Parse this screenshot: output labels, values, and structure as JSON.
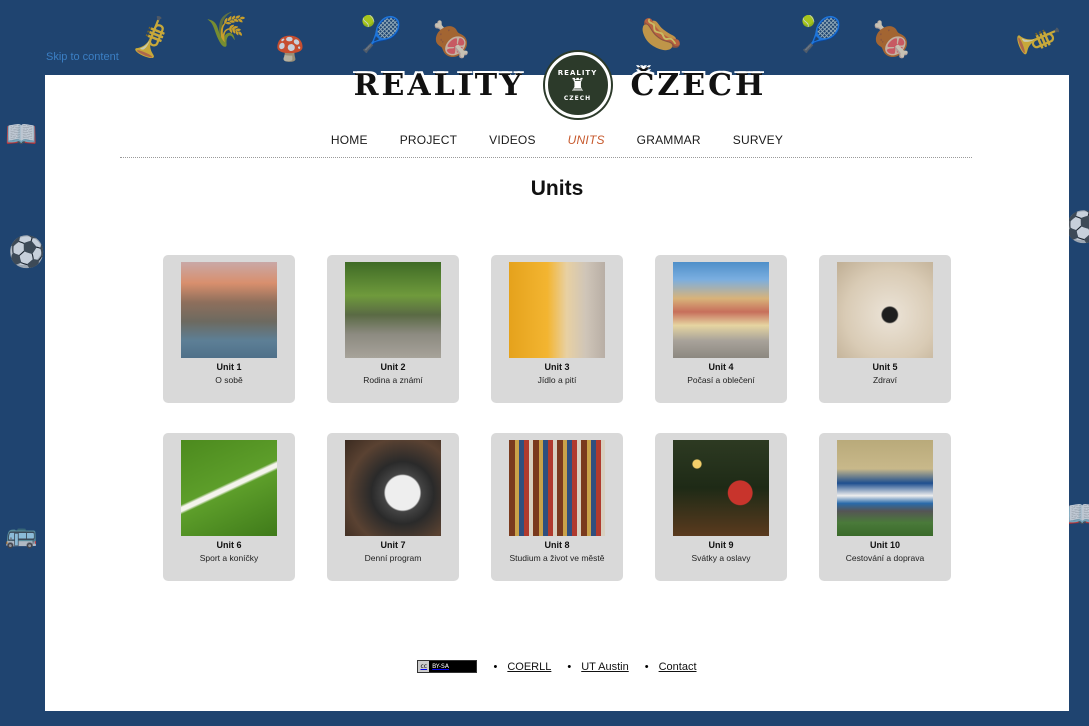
{
  "skip_link": "Skip to content",
  "logo": {
    "word1": "REALITY",
    "word2": "ČZECH",
    "seal_top": "REALITY",
    "seal_bottom": "CZECH"
  },
  "nav": [
    {
      "label": "HOME",
      "active": false
    },
    {
      "label": "PROJECT",
      "active": false
    },
    {
      "label": "VIDEOS",
      "active": false
    },
    {
      "label": "UNITS",
      "active": true
    },
    {
      "label": "GRAMMAR",
      "active": false
    },
    {
      "label": "SURVEY",
      "active": false
    }
  ],
  "page_title": "Units",
  "units": [
    {
      "title": "Unit 1",
      "subtitle": "O sobě",
      "icon": "prague-city-photo"
    },
    {
      "title": "Unit 2",
      "subtitle": "Rodina a známí",
      "icon": "park-people-photo"
    },
    {
      "title": "Unit 3",
      "subtitle": "Jídlo a pití",
      "icon": "beer-mug-photo"
    },
    {
      "title": "Unit 4",
      "subtitle": "Počasí a oblečení",
      "icon": "town-square-photo"
    },
    {
      "title": "Unit 5",
      "subtitle": "Zdraví",
      "icon": "stethoscope-photo"
    },
    {
      "title": "Unit 6",
      "subtitle": "Sport a koníčky",
      "icon": "football-field-photo"
    },
    {
      "title": "Unit 7",
      "subtitle": "Denní program",
      "icon": "wristwatch-photo"
    },
    {
      "title": "Unit 8",
      "subtitle": "Studium a život ve městě",
      "icon": "bookshelf-photo"
    },
    {
      "title": "Unit 9",
      "subtitle": "Svátky a oslavy",
      "icon": "christmas-ornaments-photo"
    },
    {
      "title": "Unit 10",
      "subtitle": "Cestování a doprava",
      "icon": "train-photo"
    }
  ],
  "footer": {
    "license_left": "cc",
    "license_right": "BY-SA",
    "links": [
      "COERLL",
      "UT Austin",
      "Contact"
    ]
  },
  "colors": {
    "background": "#1f4470",
    "active_nav": "#c75a2e",
    "card": "#d9d9d9"
  }
}
